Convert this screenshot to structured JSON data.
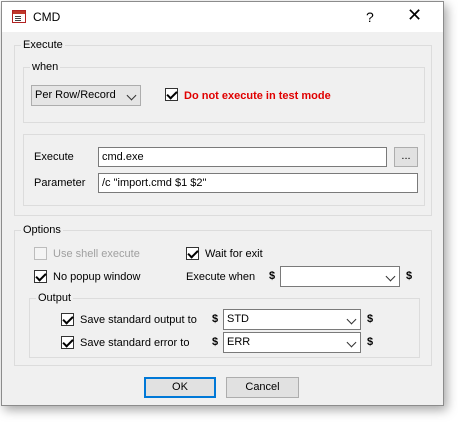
{
  "window": {
    "title": "CMD",
    "help_label": "?",
    "close_label": "✕",
    "icon": "app-cmd-icon"
  },
  "execute": {
    "legend": "Execute",
    "when": {
      "legend": "when",
      "mode_value": "Per Row/Record",
      "test_mode_checked": true,
      "test_mode_label": "Do not execute in test mode",
      "test_mode_color": "#e00000"
    },
    "execute_label": "Execute",
    "execute_value": "cmd.exe",
    "browse_label": "...",
    "parameter_label": "Parameter",
    "parameter_value": "/c \"import.cmd $1 $2\""
  },
  "options": {
    "legend": "Options",
    "use_shell_label": "Use shell execute",
    "use_shell_checked": false,
    "use_shell_enabled": false,
    "wait_label": "Wait for exit",
    "wait_checked": true,
    "no_popup_label": "No popup window",
    "no_popup_checked": true,
    "execute_when_label": "Execute when",
    "execute_when_value": "",
    "dollar": "$",
    "output": {
      "legend": "Output",
      "stdout_label": "Save standard output to",
      "stdout_checked": true,
      "stdout_value": "STD",
      "stderr_label": "Save standard error to",
      "stderr_checked": true,
      "stderr_value": "ERR"
    }
  },
  "buttons": {
    "ok": "OK",
    "cancel": "Cancel"
  }
}
